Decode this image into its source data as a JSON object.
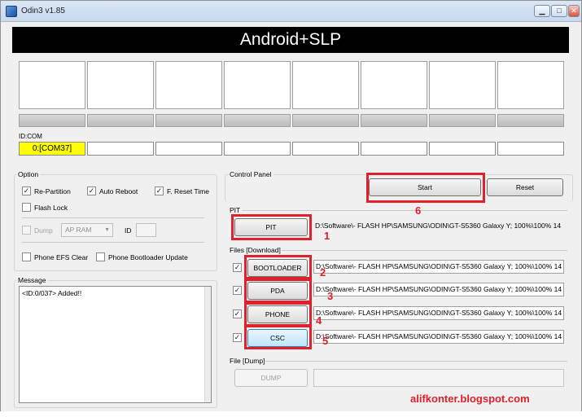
{
  "window": {
    "title": "Odin3 v1.85",
    "min_glyph": "▁",
    "max_glyph": "□",
    "close_glyph": "✕"
  },
  "banner": "Android+SLP",
  "slots": {
    "idcom_label": "ID:COM",
    "com_ports": [
      "0:[COM37]",
      "",
      "",
      "",
      "",
      "",
      "",
      ""
    ]
  },
  "option": {
    "label": "Option",
    "re_partition": {
      "label": "Re-Partition",
      "checked": true
    },
    "auto_reboot": {
      "label": "Auto Reboot",
      "checked": true
    },
    "f_reset_time": {
      "label": "F. Reset Time",
      "checked": true
    },
    "flash_lock": {
      "label": "Flash Lock",
      "checked": false
    },
    "dump": {
      "label": "Dump",
      "checked": false
    },
    "dump_select": "AP RAM",
    "id_label": "ID",
    "phone_efs_clear": {
      "label": "Phone EFS Clear",
      "checked": false
    },
    "phone_bootloader_update": {
      "label": "Phone Bootloader Update",
      "checked": false
    }
  },
  "message": {
    "label": "Message",
    "text": "<ID:0/037> Added!!"
  },
  "control_panel": {
    "label": "Control Panel",
    "start": "Start",
    "reset": "Reset"
  },
  "pit": {
    "label": "PIT",
    "button": "PIT",
    "path": "D:\\Software\\- FLASH HP\\SAMSUNG\\ODIN\\GT-S5360 Galaxy Y; 100%\\100% 14"
  },
  "files": {
    "label": "Files [Download]",
    "rows": [
      {
        "button": "BOOTLOADER",
        "checked": true,
        "path": "D:\\Software\\- FLASH HP\\SAMSUNG\\ODIN\\GT-S5360 Galaxy Y; 100%\\100% 14"
      },
      {
        "button": "PDA",
        "checked": true,
        "path": "D:\\Software\\- FLASH HP\\SAMSUNG\\ODIN\\GT-S5360 Galaxy Y; 100%\\100% 14"
      },
      {
        "button": "PHONE",
        "checked": true,
        "path": "D:\\Software\\- FLASH HP\\SAMSUNG\\ODIN\\GT-S5360 Galaxy Y; 100%\\100% 14"
      },
      {
        "button": "CSC",
        "checked": true,
        "path": "D:\\Software\\- FLASH HP\\SAMSUNG\\ODIN\\GT-S5360 Galaxy Y; 100%\\100% 14"
      }
    ]
  },
  "dump": {
    "label": "File [Dump]",
    "button": "DUMP"
  },
  "annotations": {
    "pit": "1",
    "bootloader": "2",
    "pda": "3",
    "phone": "4",
    "csc": "5",
    "start": "6"
  },
  "watermark": "alifkonter.blogspot.com",
  "colors": {
    "highlight": "#e0202a",
    "active_port": "#ffff00",
    "banner_bg": "#000000"
  }
}
